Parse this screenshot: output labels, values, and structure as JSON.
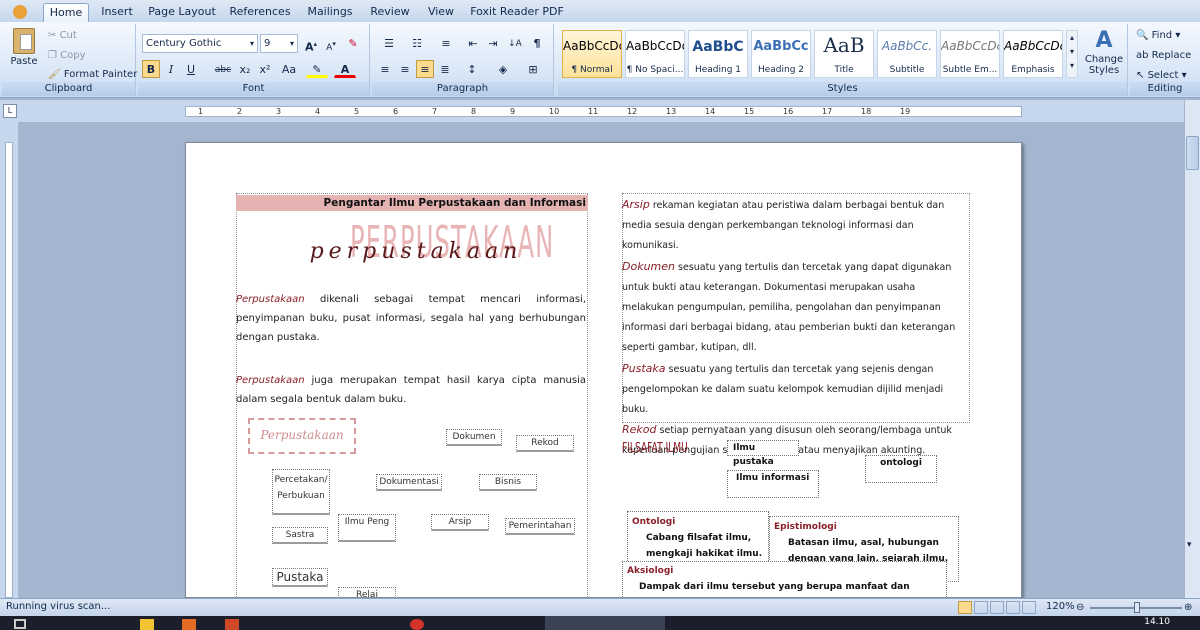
{
  "tabs": [
    "Home",
    "Insert",
    "Page Layout",
    "References",
    "Mailings",
    "Review",
    "View",
    "Foxit Reader PDF"
  ],
  "clipboard": {
    "paste": "Paste",
    "cut": "Cut",
    "copy": "Copy",
    "format_painter": "Format Painter",
    "label": "Clipboard"
  },
  "font": {
    "name": "Century Gothic",
    "size": "9",
    "label": "Font",
    "bold": "B",
    "italic": "I",
    "underline": "U",
    "strike": "abc",
    "sub": "x₂",
    "sup": "x²",
    "case": "Aa"
  },
  "paragraph": {
    "label": "Paragraph",
    "show_marks": "¶"
  },
  "styles": {
    "label": "Styles",
    "change": "Change Styles",
    "items": [
      {
        "sample": "AaBbCcDc",
        "name": "¶ Normal"
      },
      {
        "sample": "AaBbCcDc",
        "name": "¶ No Spaci..."
      },
      {
        "sample": "AaBbC",
        "name": "Heading 1"
      },
      {
        "sample": "AaBbCc",
        "name": "Heading 2"
      },
      {
        "sample": "AaB",
        "name": "Title"
      },
      {
        "sample": "AaBbCc.",
        "name": "Subtitle"
      },
      {
        "sample": "AaBbCcDc",
        "name": "Subtle Em..."
      },
      {
        "sample": "AaBbCcDc",
        "name": "Emphasis"
      }
    ]
  },
  "editing": {
    "label": "Editing",
    "find": "Find",
    "replace": "Replace",
    "select": "Select"
  },
  "ruler_marks": [
    "1",
    "2",
    "3",
    "4",
    "5",
    "6",
    "7",
    "8",
    "9",
    "10",
    "11",
    "12",
    "13",
    "14",
    "15",
    "16",
    "17",
    "18",
    "19"
  ],
  "doc": {
    "header_band": "Pengantar Ilmu Perpustakaan dan Informasi",
    "big_title_bg": "PERPUSTAKAAN",
    "big_title_fg": "perpustakaan",
    "p1_kw": "Perpustakaan",
    "p1": " dikenali sebagai tempat mencari informasi, penyimpanan buku, pusat informasi, segala hal yang berhubungan dengan pustaka.",
    "p2_kw": "Perpustakaan",
    "p2": " juga merupakan tempat hasil karya cipta manusia dalam segala bentuk dalam buku.",
    "mindmap": {
      "center": "Perpustakaan",
      "nodes": [
        "Dokumen",
        "Rekod",
        "Percetakan/ Perbukuan",
        "Dokumentasi",
        "Bisnis",
        "Ilmu Peng",
        "Arsip",
        "Pemerintahan",
        "Sastra",
        "Pustaka",
        "Relai"
      ]
    },
    "r1_kw": "Arsip",
    "r1": " rekaman kegiatan atau peristiwa dalam berbagai bentuk dan media sesuia dengan perkembangan teknologi informasi dan komunikasi.",
    "r2_kw": "Dokumen",
    "r2": " sesuatu yang tertulis dan tercetak yang dapat digunakan untuk bukti atau keterangan. Dokumentasi merupakan usaha melakukan pengumpulan, pemiliha, pengolahan dan penyimpanan informasi dari berbagai bidang, atau pemberian bukti dan keterangan seperti gambar, kutipan, dll.",
    "r3_kw": "Pustaka",
    "r3": " sesuatu yang tertulis dan tercetak yang sejenis dengan pengelompokan ke dalam suatu kelompok kemudian dijilid menjadi buku.",
    "r4_kw": "Rekod",
    "r4": " setiap pernyataan yang disusun oleh seorang/lembaga untuk keperluan pengujian suatu peristiwa atau menyajikan akunting.",
    "filsafat": "FILSAFAT ILMU",
    "ilmu_pustaka": "Ilmu pustaka",
    "ilmu_informasi": "Ilmu informasi",
    "ontologi_box": "ontologi",
    "ontologi_title": "Ontologi",
    "ontologi_text": "Cabang filsafat ilmu, mengkaji hakikat ilmu.",
    "episte_title": "Epistimologi",
    "episte_text": "Batasan ilmu, asal, hubungan dengan yang lain, sejarah ilmu.",
    "aksiologi_title": "Aksiologi",
    "aksiologi_text": "Dampak dari ilmu tersebut yang berupa manfaat dan fungsi."
  },
  "status": {
    "left": "Running virus scan...",
    "zoom": "120%"
  },
  "taskbar": {
    "time": "14.10"
  }
}
